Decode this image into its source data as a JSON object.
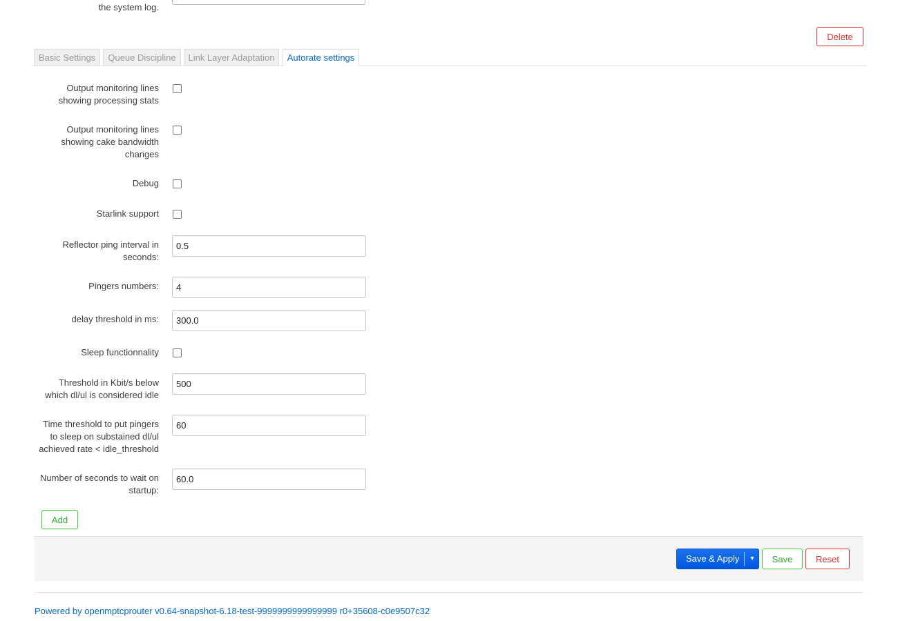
{
  "top": {
    "label_tail": "the system log."
  },
  "delete_label": "Delete",
  "tabs": [
    {
      "label": "Basic Settings",
      "active": false
    },
    {
      "label": "Queue Discipline",
      "active": false
    },
    {
      "label": "Link Layer Adaptation",
      "active": false
    },
    {
      "label": "Autorate settings",
      "active": true
    }
  ],
  "fields": {
    "output_stats": {
      "label_l1": "Output monitoring lines",
      "label_l2": "showing processing stats",
      "checked": false
    },
    "output_bw": {
      "label_l1": "Output monitoring lines",
      "label_l2": "showing cake bandwidth",
      "label_l3": "changes",
      "checked": false
    },
    "debug": {
      "label": "Debug",
      "checked": false
    },
    "starlink": {
      "label": "Starlink support",
      "checked": false
    },
    "ping_interval": {
      "label_l1": "Reflector ping interval in",
      "label_l2": "seconds:",
      "value": "0.5"
    },
    "pingers": {
      "label": "Pingers numbers:",
      "value": "4"
    },
    "delay": {
      "label": "delay threshold in ms:",
      "value": "300.0"
    },
    "sleep": {
      "label": "Sleep functionnality",
      "checked": false
    },
    "idle_threshold": {
      "label_l1": "Threshold in Kbit/s below",
      "label_l2": "which dl/ul is considered idle",
      "value": "500"
    },
    "sleep_time": {
      "label_l1": "Time threshold to put pingers",
      "label_l2": "to sleep on substained dl/ul",
      "label_l3": "achieved rate < idle_threshold",
      "value": "60"
    },
    "startup_wait": {
      "label_l1": "Number of seconds to wait on",
      "label_l2": "startup:",
      "value": "60.0"
    }
  },
  "add_label": "Add",
  "actions": {
    "save_apply_label": "Save & Apply",
    "caret": "▾",
    "save_label": "Save",
    "reset_label": "Reset"
  },
  "footer": {
    "prefix": "Powered by ",
    "link": "openmptcprouter v0.64-snapshot-6.18-test-9999999999999999 r0+35608-c0e9507c32"
  },
  "colors": {
    "accent": "#0069d6",
    "primary_button": "#0058e0",
    "positive": "#33aa33",
    "negative": "#dd3333"
  }
}
